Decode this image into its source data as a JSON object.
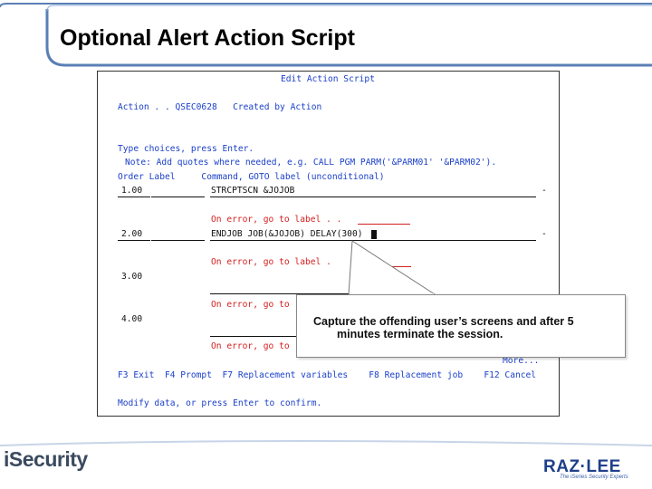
{
  "slide": {
    "title": "Optional Alert Action Script"
  },
  "screen": {
    "header": "Edit Action Script",
    "action_line": "Action . . QSEC0628   Created by Action",
    "type_choices": "Type choices, press Enter.",
    "note": "Note: Add quotes where needed, e.g. CALL PGM PARM('&PARM01' '&PARM02').",
    "column_headers": "Order Label     Command, GOTO label (unconditional)",
    "rows": [
      {
        "order": "1.00",
        "command": "STRCPTSCN &JOJOB",
        "continuation": "-",
        "on_error": "On error, go to label . ."
      },
      {
        "order": "2.00",
        "command": "ENDJOB JOB(&JOJOB) DELAY(300)",
        "continuation": "-",
        "on_error": "On error, go to label ."
      },
      {
        "order": "3.00",
        "command": "",
        "continuation": "",
        "on_error": "On error, go to"
      },
      {
        "order": "4.00",
        "command": "",
        "continuation": "",
        "on_error": "On error, go to"
      }
    ],
    "more": "More...",
    "function_keys": "F3 Exit  F4 Prompt  F7 Replacement variables    F8 Replacement job    F12 Cancel",
    "confirm": "Modify data, or press Enter to confirm."
  },
  "callout": {
    "line1": "Capture the offending user’s screens and after 5",
    "line2": "minutes terminate the session."
  },
  "footer": {
    "left_logo": "iSecurity",
    "right_logo": "RAZ·LEE",
    "right_tagline": "The iSeries Security Experts"
  }
}
